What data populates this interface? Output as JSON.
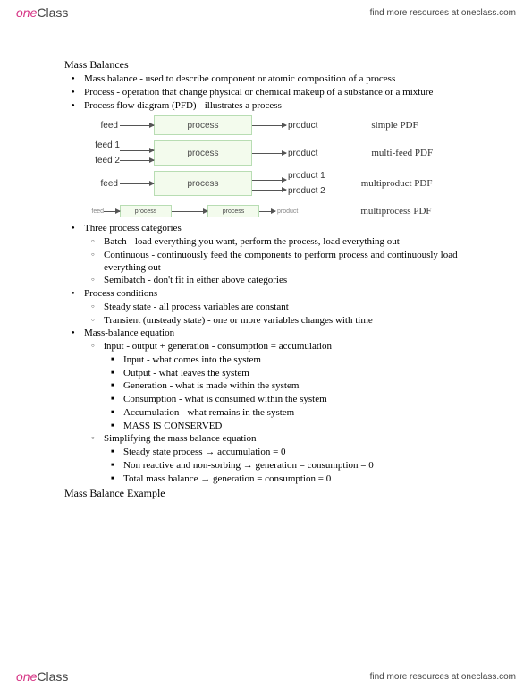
{
  "brand": {
    "one": "one",
    "class": "Class"
  },
  "header_link": "find more resources at oneclass.com",
  "footer_link": "find more resources at oneclass.com",
  "title": "Mass Balances",
  "top_bullets": [
    "Mass balance - used to describe component or atomic composition of a process",
    "Process - operation that change physical or chemical makeup of a substance or a mixture",
    "Process flow diagram (PFD) - illustrates a process"
  ],
  "diagrams": {
    "simple": {
      "feed": "feed",
      "process": "process",
      "product": "product",
      "caption": "simple PDF"
    },
    "multifeed": {
      "feed1": "feed 1",
      "feed2": "feed 2",
      "process": "process",
      "product": "product",
      "caption": "multi-feed PDF"
    },
    "multiproduct": {
      "feed": "feed",
      "process": "process",
      "product1": "product 1",
      "product2": "product 2",
      "caption": "multiproduct PDF"
    },
    "multiprocess": {
      "feed": "feed",
      "process": "process",
      "product": "product",
      "caption": "multiprocess PDF"
    }
  },
  "mid_bullets": {
    "cat_head": "Three process categories",
    "cat": [
      "Batch - load everything you want, perform the process, load everything out",
      "Continuous - continuously feed the components to perform process and continuously load everything out",
      "Semibatch - don't fit in either above categories"
    ],
    "cond_head": "Process conditions",
    "cond": [
      "Steady state - all process variables are constant",
      "Transient (unsteady state) - one or more variables changes with time"
    ],
    "eq_head": "Mass-balance equation",
    "eq_line": "input - output + generation - consumption = accumulation",
    "eq_sub": [
      "Input - what comes into the system",
      "Output - what leaves the system",
      "Generation - what is made within the system",
      "Consumption - what is consumed within the system",
      "Accumulation - what remains in the system",
      "MASS IS CONSERVED"
    ],
    "simp_head": "Simplifying the mass balance equation",
    "simp": [
      "Steady state process → accumulation = 0",
      "Non reactive and non-sorbing → generation = consumption = 0",
      "Total mass balance → generation = consumption = 0"
    ]
  },
  "example_title": "Mass Balance Example"
}
